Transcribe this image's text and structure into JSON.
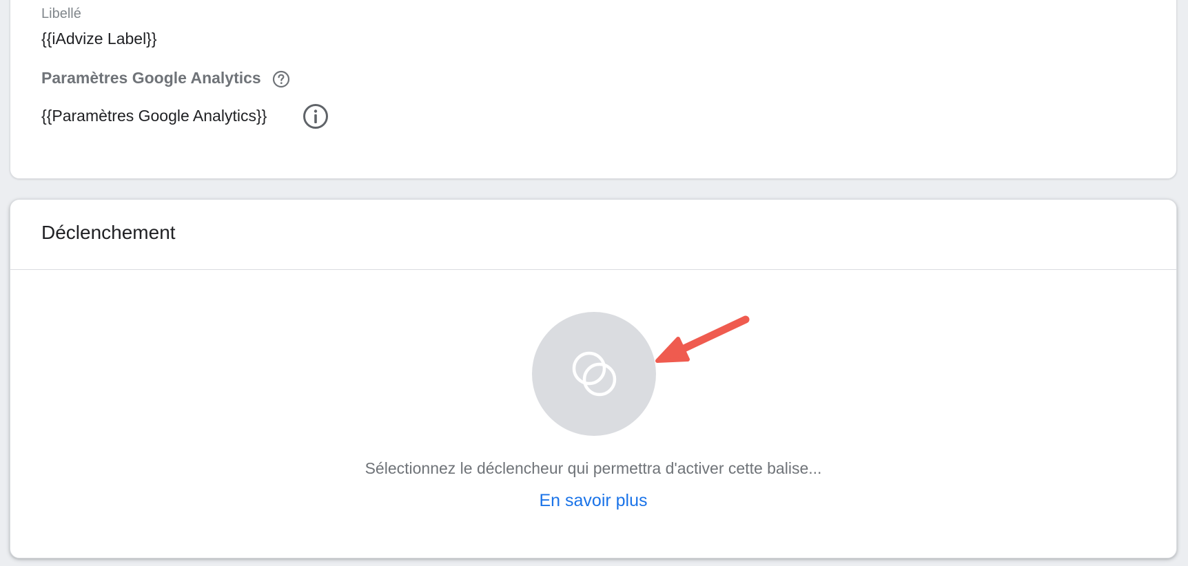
{
  "fields": {
    "label_title": "Libellé",
    "label_value": "{{iAdvize Label}}",
    "ga_settings_title": "Paramètres Google Analytics",
    "ga_settings_value": "{{Paramètres Google Analytics}}"
  },
  "triggering": {
    "title": "Déclenchement",
    "empty_message": "Sélectionnez le déclencheur qui permettra d'activer cette balise...",
    "learn_more": "En savoir plus"
  },
  "icons": {
    "help": "help-circle-icon",
    "info": "info-circle-icon",
    "trigger": "trigger-icon",
    "annotation": "arrow-annotation"
  },
  "colors": {
    "link": "#1a73e8",
    "arrow": "#ef5b4f",
    "circle": "#dadce0"
  }
}
